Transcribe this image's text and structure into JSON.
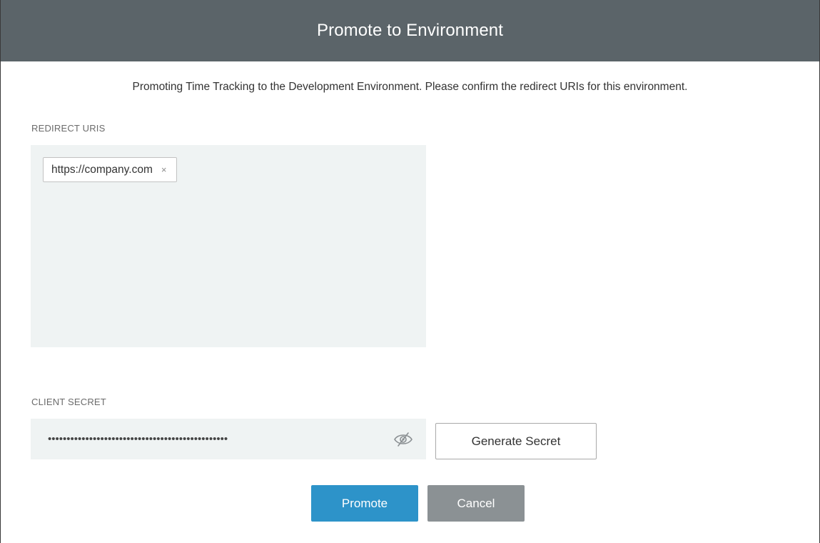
{
  "dialog": {
    "title": "Promote to Environment",
    "description": "Promoting Time Tracking to the Development Environment. Please confirm the redirect URIs for this environment."
  },
  "redirect_uris": {
    "label": "REDIRECT URIS",
    "items": [
      {
        "value": "https://company.com",
        "remove_glyph": "×"
      }
    ]
  },
  "client_secret": {
    "label": "CLIENT SECRET",
    "masked_value": "••••••••••••••••••••••••••••••••••••••••••••••••",
    "visibility_icon": "eye-slash-icon",
    "generate_label": "Generate Secret"
  },
  "actions": {
    "promote_label": "Promote",
    "cancel_label": "Cancel"
  },
  "colors": {
    "header_bg": "#5b6469",
    "primary": "#2d93c9",
    "secondary": "#8b9194",
    "field_bg": "#eff3f3"
  }
}
